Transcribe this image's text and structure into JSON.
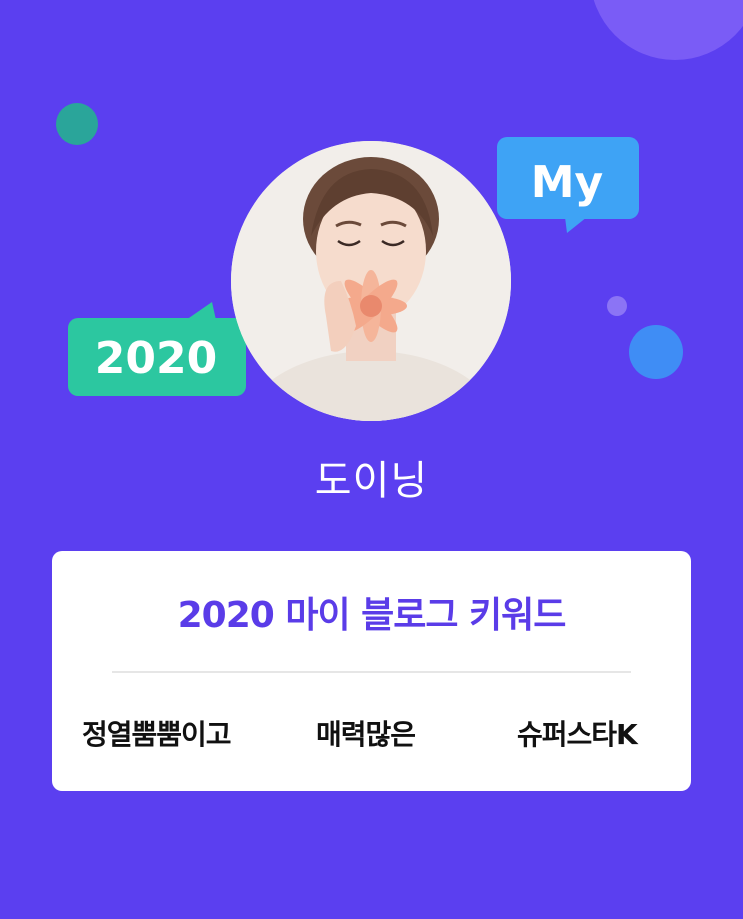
{
  "bubbles": {
    "my_label": "My",
    "year_label": "2020"
  },
  "profile": {
    "name": "도이닝"
  },
  "card": {
    "title": "2020 마이 블로그 키워드",
    "keywords": [
      "정열뿜뿜이고",
      "매력많은",
      "슈퍼스타K"
    ]
  },
  "colors": {
    "background": "#5b3ff0",
    "title_text": "#5a3ce8",
    "bubble_my": "#3ea3f5",
    "bubble_2020": "#2cc7a0"
  }
}
